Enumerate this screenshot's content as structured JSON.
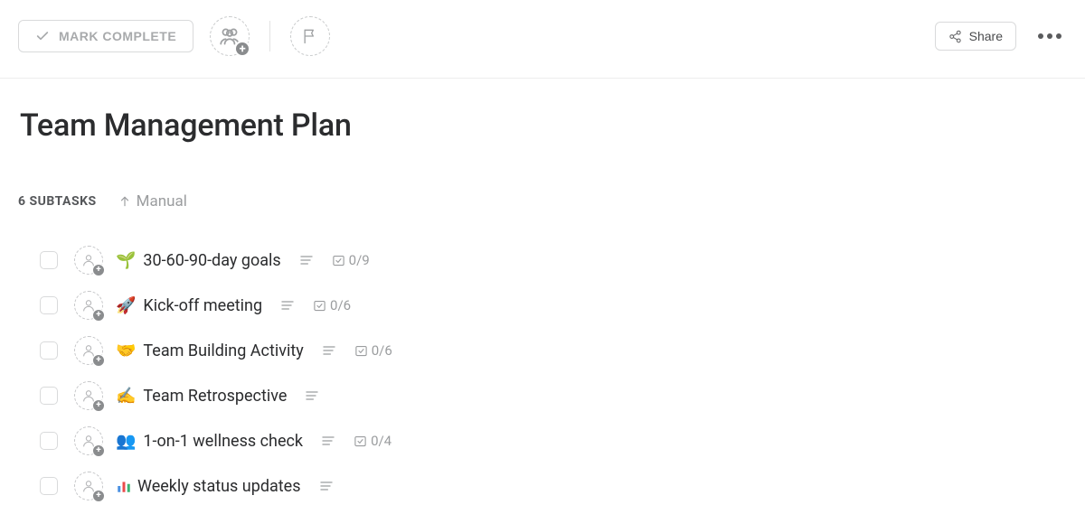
{
  "toolbar": {
    "mark_complete_label": "MARK COMPLETE",
    "share_label": "Share"
  },
  "page": {
    "title": "Team Management Plan"
  },
  "subtasks_header": {
    "count_label": "6 SUBTASKS",
    "sort_label": "Manual"
  },
  "subtasks": [
    {
      "emoji": "🌱",
      "title": "30-60-90-day goals",
      "has_description": true,
      "sub_count": "0/9"
    },
    {
      "emoji": "🚀",
      "title": "Kick-off meeting",
      "has_description": true,
      "sub_count": "0/6"
    },
    {
      "emoji": "🤝",
      "title": "Team Building Activity",
      "has_description": true,
      "sub_count": "0/6"
    },
    {
      "emoji": "✍️",
      "title": "Team Retrospective",
      "has_description": true,
      "sub_count": null
    },
    {
      "emoji": "👥",
      "title": "1-on-1 wellness check",
      "has_description": true,
      "sub_count": "0/4"
    },
    {
      "emoji": "__barchart__",
      "title": "Weekly status updates",
      "has_description": true,
      "sub_count": null
    }
  ]
}
